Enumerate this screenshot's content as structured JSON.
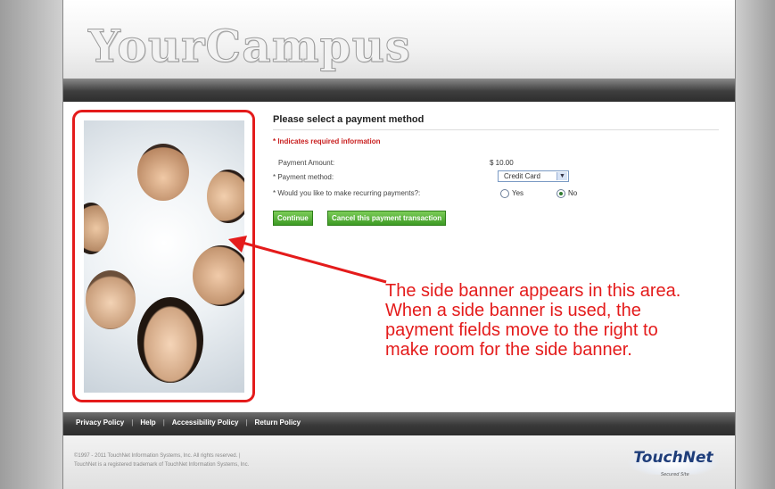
{
  "header": {
    "logo_text": "YourCampus"
  },
  "form": {
    "title": "Please select a payment method",
    "required_note": "* Indicates required information",
    "amount_label": "Payment Amount:",
    "amount_value": "$ 10.00",
    "method_label": "* Payment method:",
    "method_selected": "Credit Card",
    "recurring_label": "* Would you like to make recurring payments?:",
    "radio_yes": "Yes",
    "radio_no": "No",
    "recurring_selected": "No",
    "continue_button": "Continue",
    "cancel_button": "Cancel this payment transaction"
  },
  "annotation": {
    "text": "The side banner appears in this area. When a side banner is used, the payment fields move to the right to make room for the side banner.",
    "color": "#e41b1b"
  },
  "footer": {
    "links": [
      "Privacy Policy",
      "Help",
      "Accessibility Policy",
      "Return Policy"
    ],
    "copyright_line1": "©1997 - 2011 TouchNet Information Systems, Inc. All rights reserved. |",
    "copyright_line2": "TouchNet is a registered trademark of TouchNet Information Systems, Inc.",
    "brand_logo": "TouchNet",
    "brand_sub": "Secured Site"
  }
}
